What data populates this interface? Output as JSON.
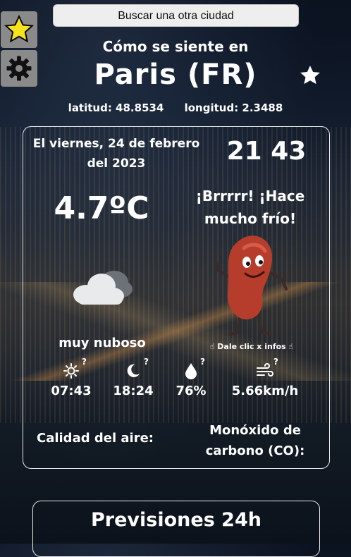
{
  "search": {
    "label": "Buscar una otra ciudad"
  },
  "intro": "Cómo se siente en",
  "city": "Paris (FR)",
  "coords": {
    "latitude": "latitud: 48.8534",
    "longitude": "longitud: 2.3488"
  },
  "weather": {
    "date": "El viernes, 24 de febrero del 2023",
    "time": "21 43",
    "temperature": "4.7ºC",
    "feeling": "¡Brrrrr! ¡Hace mucho frío!",
    "description": "muy nuboso",
    "hint": "☝ Dale clic x infos ☝",
    "stats": [
      {
        "icon": "sun-icon",
        "value": "07:43"
      },
      {
        "icon": "moon-icon",
        "value": "18:24"
      },
      {
        "icon": "drop-icon",
        "value": "76%"
      },
      {
        "icon": "wind-icon",
        "value": "5.66km/h"
      }
    ],
    "question_mark": "?",
    "air_quality": "Calidad del aire:",
    "co": "Monóxido de carbono (CO):"
  },
  "forecast": {
    "title": "Previsiones 24h"
  },
  "colors": {
    "star": "#f7e31b",
    "mascot": "#b63d2b"
  }
}
